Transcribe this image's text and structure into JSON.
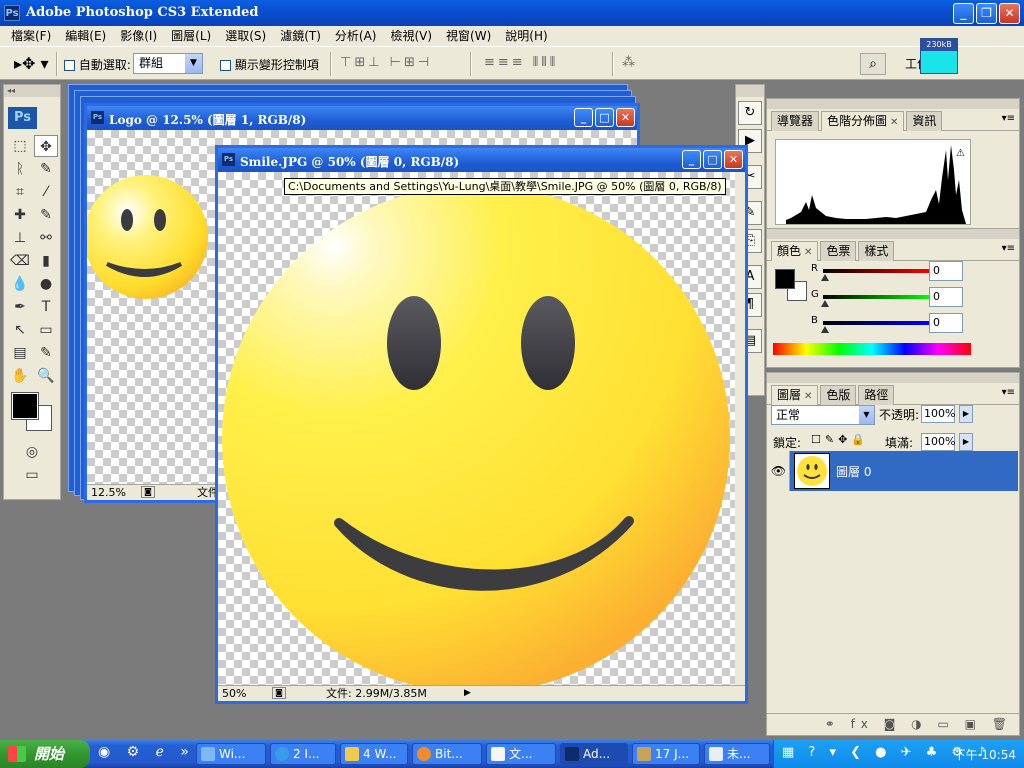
{
  "window": {
    "title": "Adobe Photoshop CS3 Extended",
    "app_icon_text": "Ps",
    "min": "_",
    "max": "❐",
    "close": "✕"
  },
  "menubar": [
    "檔案(F)",
    "編輯(E)",
    "影像(I)",
    "圖層(L)",
    "選取(S)",
    "濾鏡(T)",
    "分析(A)",
    "檢視(V)",
    "視窗(W)",
    "說明(H)"
  ],
  "optionsbar": {
    "auto_select_label": "自動選取:",
    "auto_select_value": "群組",
    "show_transform_label": "顯示變形控制項",
    "workspace_label": "工作",
    "memory_label": "230kB"
  },
  "toolbox": {
    "logo": "Ps",
    "tools": [
      "⬚",
      "✥",
      "ᚱ",
      "✎",
      "⌗",
      "⁄",
      "✚",
      "✎",
      "⊥",
      "⚯",
      "⌫",
      "▮",
      "💧",
      "●",
      "✒",
      "T",
      "↖",
      "▭",
      "▤",
      "✎",
      "✋",
      "🔍"
    ]
  },
  "docs": {
    "logo": {
      "title": "Logo @ 12.5% (圖層 1, RGB/8)",
      "zoom": "12.5%",
      "status": "文件"
    },
    "smile": {
      "title": "Smile.JPG @ 50% (圖層 0, RGB/8)",
      "zoom": "50%",
      "status": "文件: 2.99M/3.85M"
    },
    "tooltip": "C:\\Documents and Settings\\Yu-Lung\\桌面\\教學\\Smile.JPG @ 50% (圖層 0, RGB/8)"
  },
  "panels": {
    "histogram_tabs": [
      "導覽器",
      "色階分佈圖",
      "資訊"
    ],
    "color_tabs": [
      "顏色",
      "色票",
      "樣式"
    ],
    "color_values": {
      "R": "0",
      "G": "0",
      "B": "0"
    },
    "color_labels": {
      "R": "R",
      "G": "G",
      "B": "B"
    },
    "layers_tabs": [
      "圖層",
      "色版",
      "路徑"
    ],
    "blend_mode": "正常",
    "opacity_label": "不透明:",
    "opacity_value": "100%",
    "lock_label": "鎖定:",
    "fill_label": "填滿:",
    "fill_value": "100%",
    "layer_name": "圖層 0",
    "footer_icons": "⚭ fx ◙ ◑ ▭ ▣ 🗑"
  },
  "taskbar": {
    "start": "開始",
    "items": [
      "Wi...",
      "2 I...",
      "4 W...",
      "Bit...",
      "文...",
      "Ad...",
      "17 J...",
      "未..."
    ],
    "clock": "下午 10:54"
  },
  "colors": {
    "face_yellow": "#ffe23a",
    "xp_blue": "#2d6be4",
    "selected_layer": "#316ac5"
  }
}
